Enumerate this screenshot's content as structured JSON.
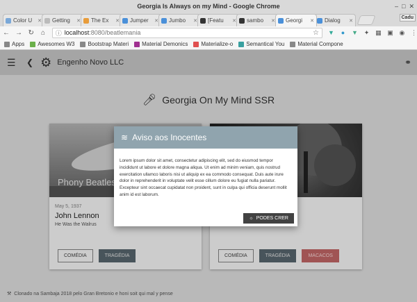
{
  "window": {
    "title": "Georgia Is Always on my Mind - Google Chrome"
  },
  "tabs": [
    {
      "label": "Color U",
      "color": "#7aa8d8"
    },
    {
      "label": "Getting",
      "color": "#bbbbbb"
    },
    {
      "label": "The Ex",
      "color": "#e89c3a"
    },
    {
      "label": "Jumper",
      "color": "#4a90d9"
    },
    {
      "label": "Jumbo",
      "color": "#4a90d9"
    },
    {
      "label": "[Featu",
      "color": "#333333"
    },
    {
      "label": "sambo",
      "color": "#333333"
    },
    {
      "label": "Georgi",
      "color": "#4a90d9"
    },
    {
      "label": "Dialog",
      "color": "#4a90d9"
    }
  ],
  "profile": "Cadu",
  "address": {
    "host": "localhost",
    "path": ":8080/beatlemania"
  },
  "bookmarks": [
    {
      "label": "Apps",
      "color": "#888888"
    },
    {
      "label": "Awesomes W3",
      "color": "#6bb04a"
    },
    {
      "label": "Bootstrap Materi",
      "color": "#888888"
    },
    {
      "label": "Material Demonics",
      "color": "#a03090"
    },
    {
      "label": "Materialize-o",
      "color": "#e05050"
    },
    {
      "label": "Semantical You",
      "color": "#3aa0a0"
    },
    {
      "label": "Material Compone",
      "color": "#888888"
    }
  ],
  "appbar": {
    "brand": "Engenho Novo LLC"
  },
  "page": {
    "heading": "Georgia On My Mind SSR"
  },
  "cards": [
    {
      "image_title": "Phony Beatles",
      "date": "May 5, 1937",
      "name": "John Lennon",
      "subtitle": "He Was the Walrus",
      "chips": [
        "COMÉDIA",
        "TRAGÉDIA"
      ]
    },
    {
      "image_title": "",
      "date": "",
      "name": "",
      "subtitle": "",
      "chips": [
        "COMÉDIA",
        "TRAGÉDIA",
        "MACACOS"
      ]
    }
  ],
  "footer": {
    "text": "Clonado na Sambaja 2018 pelo Gran Bretonio e honi soit qui mal y pense"
  },
  "dialog": {
    "title": "Aviso aos Inocentes",
    "body": "Lorem ipsum dolor sit amet, consectetur adipiscing elit, sed do eiusmod tempor incididunt ut labore et dolore magna aliqua. Ut enim ad minim veniam, quis nostrud exercitation ullamco laboris nisi ut aliquip ex ea commodo consequat. Duis aute irure dolor in reprehenderit in voluptate velit esse cillum dolore eu fugiat nulla pariatur. Excepteur sint occaecat cupidatat non proident, sunt in culpa qui officia deserunt mollit anim id est laborum.",
    "button": "PODES CRER"
  }
}
